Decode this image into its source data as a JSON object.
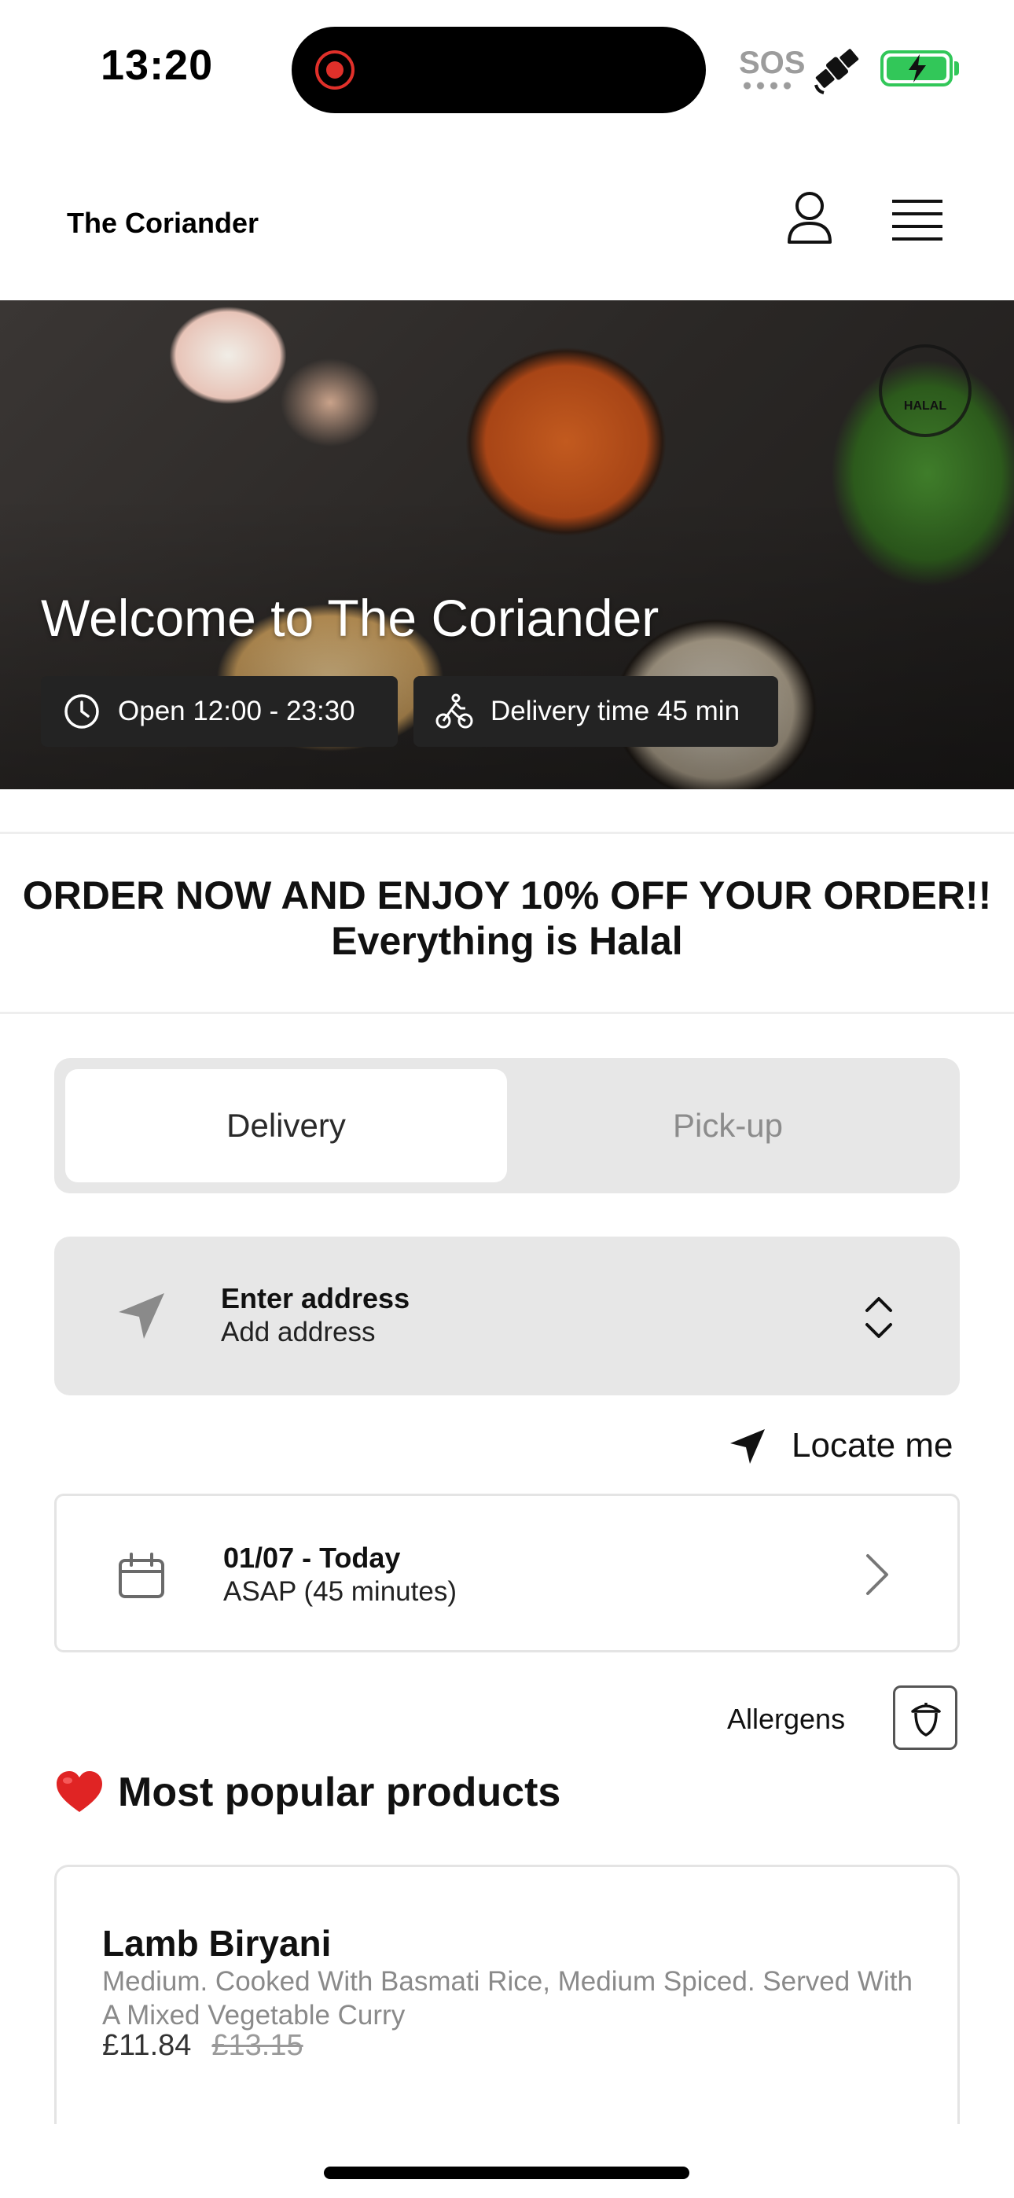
{
  "status_bar": {
    "time": "13:20",
    "sos": "SOS",
    "icons": [
      "screen-recording-icon",
      "satellite-icon",
      "battery-charging-icon"
    ],
    "battery_color": "#32c759",
    "recording_color": "#e0302a"
  },
  "header": {
    "brand": "The Coriander",
    "icons": [
      "user-icon",
      "menu-icon"
    ]
  },
  "hero": {
    "title": "Welcome to The Coriander",
    "badge": "HALAL",
    "open_hours": "Open 12:00 - 23:30",
    "delivery_time": "Delivery time 45 min"
  },
  "promo": {
    "line1": "ORDER NOW AND ENJOY 10% OFF YOUR ORDER!!",
    "line2": "Everything is Halal"
  },
  "order_type": {
    "options": [
      {
        "label": "Delivery",
        "selected": true
      },
      {
        "label": "Pick-up",
        "selected": false
      }
    ]
  },
  "address": {
    "title": "Enter address",
    "subtitle": "Add address"
  },
  "locate": {
    "label": "Locate me"
  },
  "schedule": {
    "date": "01/07 - Today",
    "time": "ASAP (45 minutes)"
  },
  "allergens": {
    "label": "Allergens"
  },
  "popular": {
    "heading": "Most popular products",
    "products": [
      {
        "name": "Lamb Biryani",
        "description": "Medium. Cooked With Basmati Rice, Medium Spiced. Served With A Mixed Vegetable Curry",
        "price": "£11.84",
        "original_price": "£13.15"
      }
    ]
  },
  "colors": {
    "pill_bg": "#232323",
    "panel_bg": "#e7e7e7",
    "heart": "#e02424"
  }
}
